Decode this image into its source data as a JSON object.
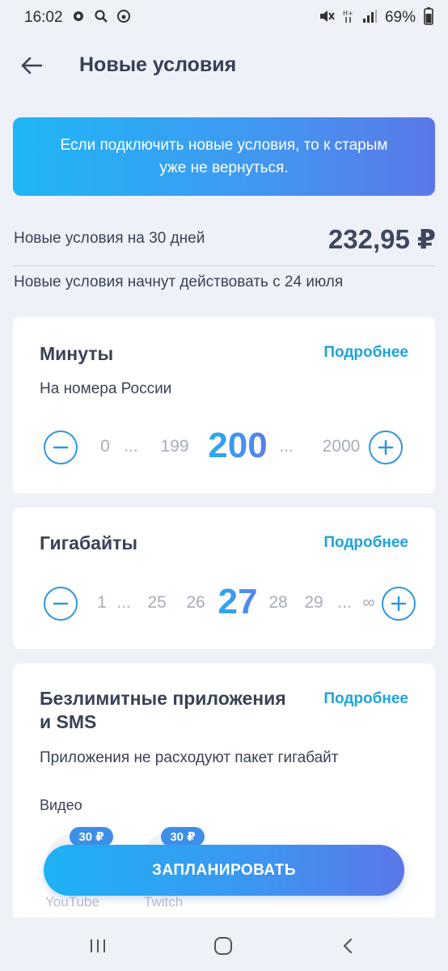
{
  "status_bar": {
    "time": "16:02",
    "battery": "69%",
    "icons": [
      "notification-icon",
      "search-icon",
      "music-icon",
      "mute-icon",
      "signal-icon",
      "battery-icon"
    ]
  },
  "header": {
    "title": "Новые условия",
    "back_icon": "arrow-left-icon"
  },
  "banner": {
    "text": "Если подключить новые условия, то к старым уже не вернуться."
  },
  "price": {
    "label": "Новые условия на 30 дней",
    "value": "232,95 ₽"
  },
  "start_note": "Новые условия начнут действовать с 24 июля",
  "minutes": {
    "title": "Минуты",
    "more": "Подробнее",
    "subtitle": "На номера России",
    "values": {
      "v1": "0",
      "e1": "...",
      "v2": "199",
      "current": "200",
      "e2": "...",
      "v3": "2000"
    }
  },
  "gigabytes": {
    "title": "Гигабайты",
    "more": "Подробнее",
    "values": {
      "v1": "1",
      "e1": "...",
      "v2": "25",
      "v3": "26",
      "current": "27",
      "v4": "28",
      "v5": "29",
      "e2": "...",
      "v6": "∞"
    }
  },
  "unlimited": {
    "title_line1": "Безлимитные приложения",
    "title_line2": "и SMS",
    "more": "Подробнее",
    "subtitle": "Приложения не расходуют пакет гигабайт",
    "section": "Видео",
    "apps": [
      {
        "name": "YouTube",
        "price": "30 ₽"
      },
      {
        "name": "Twitch",
        "price": "30 ₽"
      }
    ]
  },
  "plan_button": "ЗАПЛАНИРОВАТЬ",
  "colors": {
    "accent": "#2e97e0",
    "link": "#1ea3dd",
    "gradient_start": "#1fb6f5",
    "gradient_end": "#5b78e8"
  }
}
